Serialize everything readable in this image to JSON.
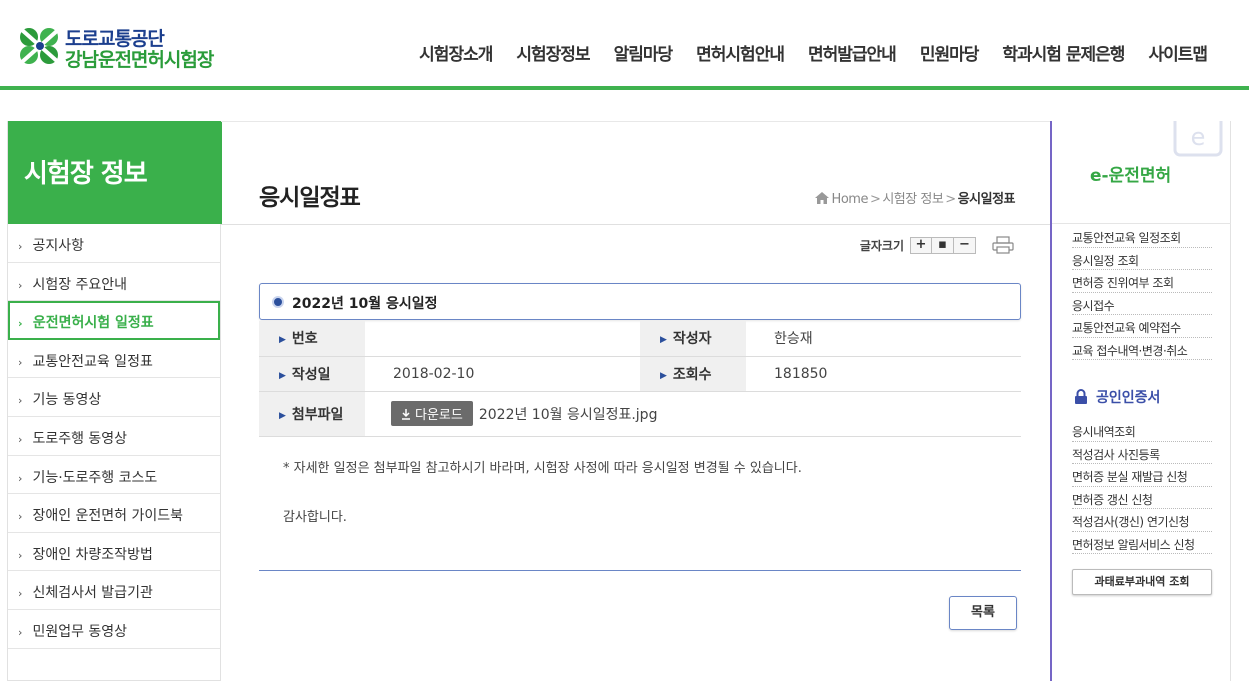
{
  "header": {
    "logo_line1": "도로교통공단",
    "logo_line2": "강남운전면허시험장",
    "nav": [
      "시험장소개",
      "시험장정보",
      "알림마당",
      "면허시험안내",
      "면허발급안내",
      "민원마당",
      "학과시험 문제은행",
      "사이트맵"
    ]
  },
  "sidebar": {
    "title": "시험장 정보",
    "items": [
      {
        "label": "공지사항",
        "active": false
      },
      {
        "label": "시험장 주요안내",
        "active": false
      },
      {
        "label": "운전면허시험 일정표",
        "active": true
      },
      {
        "label": "교통안전교육 일정표",
        "active": false
      },
      {
        "label": "기능 동영상",
        "active": false
      },
      {
        "label": "도로주행 동영상",
        "active": false
      },
      {
        "label": "기능·도로주행 코스도",
        "active": false
      },
      {
        "label": "장애인 운전면허 가이드북",
        "active": false
      },
      {
        "label": "장애인 차량조작방법",
        "active": false
      },
      {
        "label": "신체검사서 발급기관",
        "active": false
      },
      {
        "label": "민원업무 동영상",
        "active": false
      }
    ]
  },
  "page": {
    "title": "응시일정표",
    "breadcrumb": {
      "home": "Home",
      "section": "시험장 정보",
      "current": "응시일정표",
      "separator": ">"
    },
    "font_size_label": "글자크기",
    "font_buttons": [
      "+",
      "▪",
      "−"
    ]
  },
  "post": {
    "title": "2022년 10월 응시일정",
    "fields": {
      "number_label": "번호",
      "number_value": "",
      "author_label": "작성자",
      "author_value": "한승재",
      "date_label": "작성일",
      "date_value": "2018-02-10",
      "views_label": "조회수",
      "views_value": "181850",
      "attachment_label": "첨부파일",
      "download_label": "다운로드",
      "file_name": "2022년 10월 응시일정표.jpg"
    },
    "body": [
      "* 자세한 일정은 첨부파일 참고하시기 바라며, 시험장 사정에 따라 응시일정 변경될 수 있습니다.",
      "감사합니다."
    ],
    "list_button": "목록"
  },
  "right_sidebar": {
    "title": "e-운전면허",
    "links_a": [
      "교통안전교육 일정조회",
      "응시일정 조회",
      "면허증 진위여부 조회",
      "응시접수",
      "교통안전교육 예약접수",
      "교육 접수내역·변경·취소"
    ],
    "cert_title": "공인인증서",
    "links_b": [
      "응시내역조회",
      "적성검사 사진등록",
      "면허증 분실 재발급 신청",
      "면허증 갱신 신청",
      "적성검사(갱신) 연기신청",
      "면허정보 알림서비스 신청"
    ],
    "fine_button": "과태료부과내역 조회"
  },
  "colors": {
    "brand_green": "#3ab04b",
    "brand_blue": "#1c3f8e",
    "accent_blue": "#6a86c6",
    "right_border": "#7565c6"
  }
}
